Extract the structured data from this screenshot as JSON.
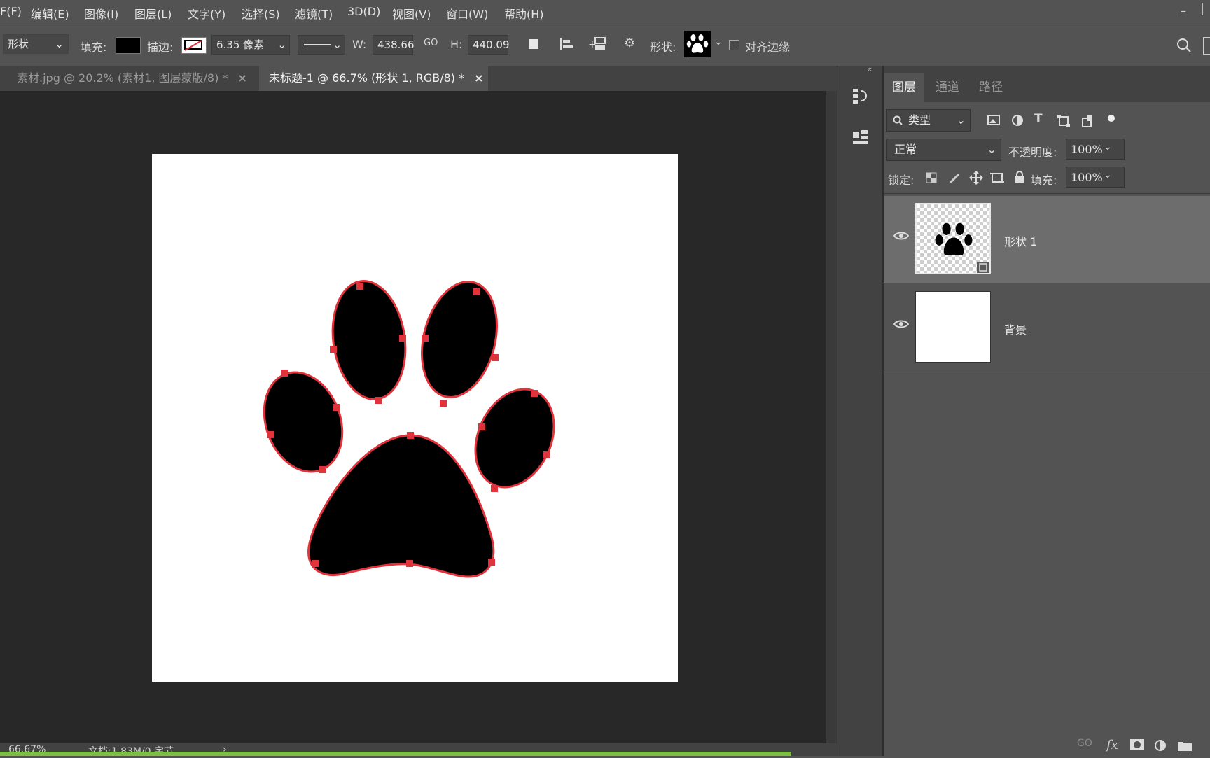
{
  "menu": [
    "F(F)",
    "编辑(E)",
    "图像(I)",
    "图层(L)",
    "文字(Y)",
    "选择(S)",
    "滤镜(T)",
    "3D(D)",
    "视图(V)",
    "窗口(W)",
    "帮助(H)"
  ],
  "window_controls": {
    "minimize": "–"
  },
  "options": {
    "tool_mode": "形状",
    "fill_label": "填充:",
    "stroke_label": "描边:",
    "stroke_width": "6.35 像素",
    "w_label": "W:",
    "w_value": "438.66",
    "link_icon": "GO",
    "h_label": "H:",
    "h_value": "440.09",
    "shape_label": "形状:",
    "align_edges_label": "对齐边缘"
  },
  "tabs": [
    {
      "label": "素材.jpg @ 20.2% (素材1, 图层蒙版/8) *",
      "close": "×"
    },
    {
      "label": "未标题-1 @ 66.7% (形状 1, RGB/8) *",
      "close": "×"
    }
  ],
  "status": {
    "zoom": "66.67%",
    "doc": "文档:1.83M/0 字节",
    "arrow": "›"
  },
  "panel": {
    "tabs": [
      "图层",
      "通道",
      "路径"
    ],
    "filter_kind": "类型",
    "blend_mode": "正常",
    "opacity_label": "不透明度:",
    "opacity_value": "100%",
    "lock_label": "锁定:",
    "fill_label": "填充:",
    "fill_value": "100%",
    "layers": [
      {
        "name": "形状 1",
        "selected": true
      },
      {
        "name": "背景",
        "selected": false
      }
    ]
  },
  "colors": {
    "fill_swatch": "#000000",
    "path_stroke": "#e0333c",
    "progress": "#7bc043"
  }
}
